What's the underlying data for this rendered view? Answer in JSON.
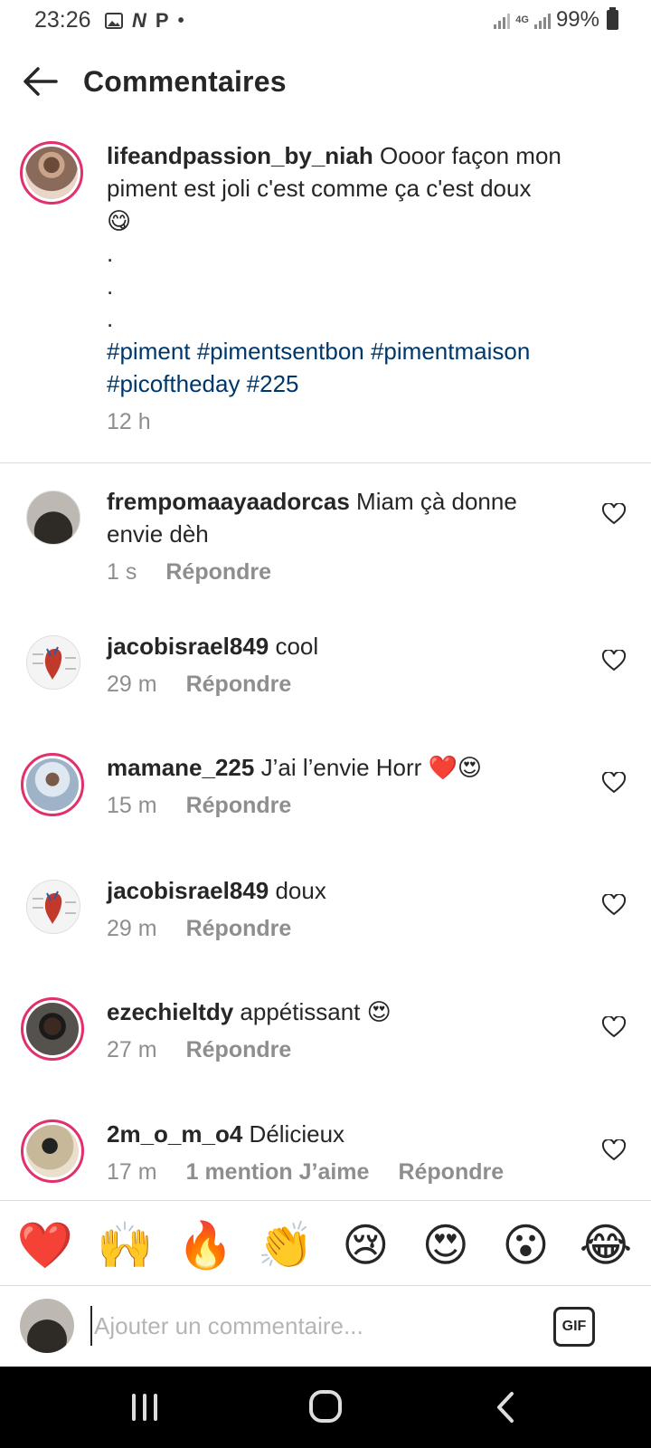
{
  "status_bar": {
    "time": "23:26",
    "notif_icons": [
      "image-icon",
      "n-icon",
      "p-icon"
    ],
    "notif_glyphs": {
      "n": "N",
      "p": "P",
      "dot": "•"
    },
    "network_label": "4G",
    "battery": "99%"
  },
  "header": {
    "title": "Commentaires",
    "back_icon": "arrow-left-icon"
  },
  "caption": {
    "username": "lifeandpassion_by_niah",
    "text": "Oooor façon mon piment est joli c'est comme ça c'est doux",
    "emoji": "😋",
    "dots": [
      ".",
      ".",
      "."
    ],
    "hashtags_line1": "#piment #pimentsentbon #pimentmaison",
    "hashtags_line2": "#picoftheday #225",
    "time": "12 h"
  },
  "comments": [
    {
      "username": "frempomaayaadorcas",
      "text": "Miam çà donne envie dèh",
      "time": "1 s",
      "reply": "Répondre",
      "likes": ""
    },
    {
      "username": "jacobisrael849",
      "text": "cool",
      "time": "29 m",
      "reply": "Répondre",
      "likes": ""
    },
    {
      "username": "mamane_225",
      "text": "J’ai l’envie Horr ❤️😍",
      "time": "15 m",
      "reply": "Répondre",
      "likes": ""
    },
    {
      "username": "jacobisrael849",
      "text": "doux",
      "time": "29 m",
      "reply": "Répondre",
      "likes": ""
    },
    {
      "username": "ezechieltdy",
      "text": "appétissant 😍",
      "time": "27 m",
      "reply": "Répondre",
      "likes": ""
    },
    {
      "username": "2m_o_m_o4",
      "text": "Délicieux",
      "time": "17 m",
      "reply": "Répondre",
      "likes": "1 mention J’aime"
    }
  ],
  "reactions": [
    "❤️",
    "🙌",
    "🔥",
    "👏",
    "😢",
    "😍",
    "😮",
    "😂"
  ],
  "composer": {
    "placeholder": "Ajouter un commentaire...",
    "gif_label": "GIF"
  },
  "nav": {
    "icons": [
      "recent-apps-icon",
      "home-icon",
      "back-icon"
    ]
  },
  "colors": {
    "accent_ring": "#e1306c",
    "hashtag": "#00376b",
    "secondary_text": "#8e8e8e",
    "divider": "#dbdbdb"
  }
}
